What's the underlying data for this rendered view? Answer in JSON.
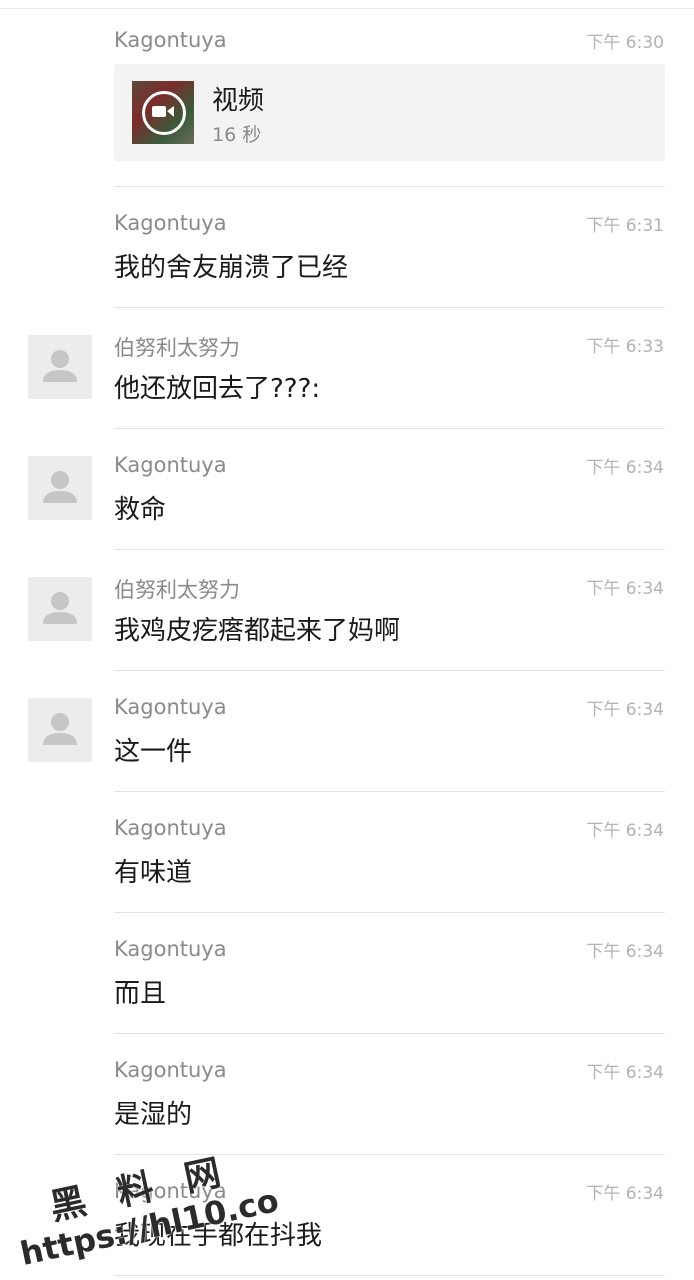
{
  "messages": [
    {
      "sender": "Kagontuya",
      "time": "下午 6:30",
      "type": "video",
      "video_title": "视频",
      "video_duration": "16 秒",
      "avatar": false
    },
    {
      "sender": "Kagontuya",
      "time": "下午 6:31",
      "text": "我的舍友崩溃了已经",
      "avatar": false
    },
    {
      "sender": "伯努利太努力",
      "time": "下午 6:33",
      "text": "他还放回去了???:",
      "avatar": true
    },
    {
      "sender": "Kagontuya",
      "time": "下午 6:34",
      "text": "救命",
      "avatar": true
    },
    {
      "sender": "伯努利太努力",
      "time": "下午 6:34",
      "text": "我鸡皮疙瘩都起来了妈啊",
      "avatar": true
    },
    {
      "sender": "Kagontuya",
      "time": "下午 6:34",
      "text": "这一件",
      "avatar": true
    },
    {
      "sender": "Kagontuya",
      "time": "下午 6:34",
      "text": "有味道",
      "avatar": false
    },
    {
      "sender": "Kagontuya",
      "time": "下午 6:34",
      "text": "而且",
      "avatar": false
    },
    {
      "sender": "Kagontuya",
      "time": "下午 6:34",
      "text": "是湿的",
      "avatar": false
    },
    {
      "sender": "Kagontuya",
      "time": "下午 6:34",
      "text": "我现在手都在抖我",
      "avatar": false
    }
  ],
  "watermark": {
    "site_name": "黑 料 网",
    "url": "https://hl10.co"
  },
  "colors": {
    "background": "#ffffff",
    "sender": "#8a8a8a",
    "time": "#b3b3b3",
    "text": "#1a1a1a",
    "avatar_bg": "#ececec",
    "avatar_figure": "#c6c6c6"
  }
}
